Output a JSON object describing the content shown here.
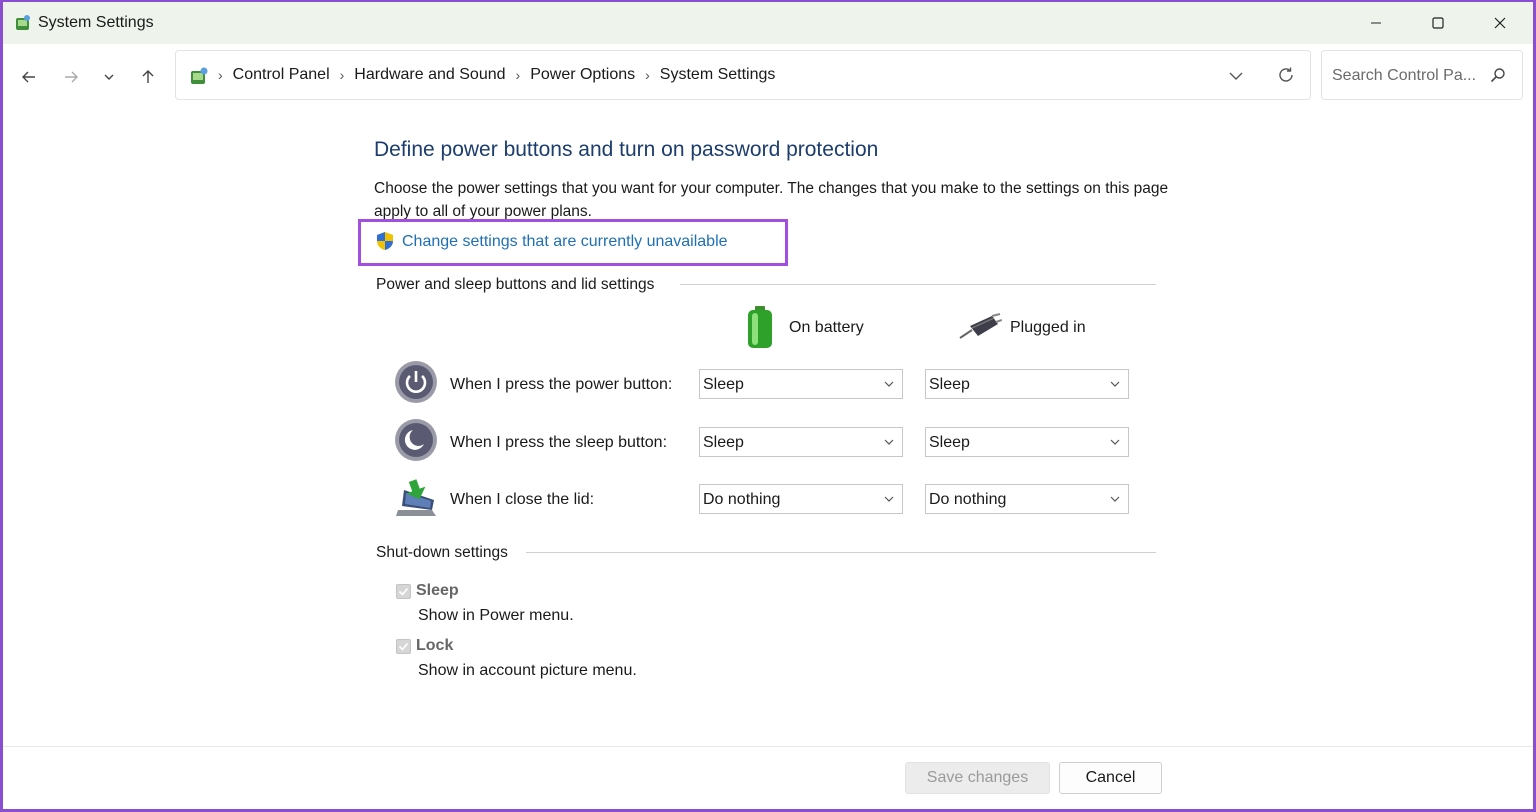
{
  "window": {
    "title": "System Settings"
  },
  "breadcrumb": {
    "items": [
      "Control Panel",
      "Hardware and Sound",
      "Power Options",
      "System Settings"
    ]
  },
  "search": {
    "placeholder": "Search Control Pa..."
  },
  "page": {
    "heading": "Define power buttons and turn on password protection",
    "description": "Choose the power settings that you want for your computer. The changes that you make to the settings on this page apply to all of your power plans.",
    "change_link": "Change settings that are currently unavailable"
  },
  "power_section": {
    "title": "Power and sleep buttons and lid settings",
    "columns": [
      "On battery",
      "Plugged in"
    ],
    "rows": [
      {
        "label": "When I press the power button:",
        "on_battery": "Sleep",
        "plugged_in": "Sleep",
        "icon": "power-button-icon"
      },
      {
        "label": "When I press the sleep button:",
        "on_battery": "Sleep",
        "plugged_in": "Sleep",
        "icon": "sleep-button-icon"
      },
      {
        "label": "When I close the lid:",
        "on_battery": "Do nothing",
        "plugged_in": "Do nothing",
        "icon": "laptop-lid-icon"
      }
    ]
  },
  "shutdown_section": {
    "title": "Shut-down settings",
    "options": [
      {
        "label": "Sleep",
        "description": "Show in Power menu.",
        "checked": true
      },
      {
        "label": "Lock",
        "description": "Show in account picture menu.",
        "checked": true
      }
    ]
  },
  "footer": {
    "save_label": "Save changes",
    "cancel_label": "Cancel"
  },
  "colors": {
    "heading": "#1c3d6e",
    "link": "#1f6fb5",
    "highlight": "#a24fe0"
  }
}
